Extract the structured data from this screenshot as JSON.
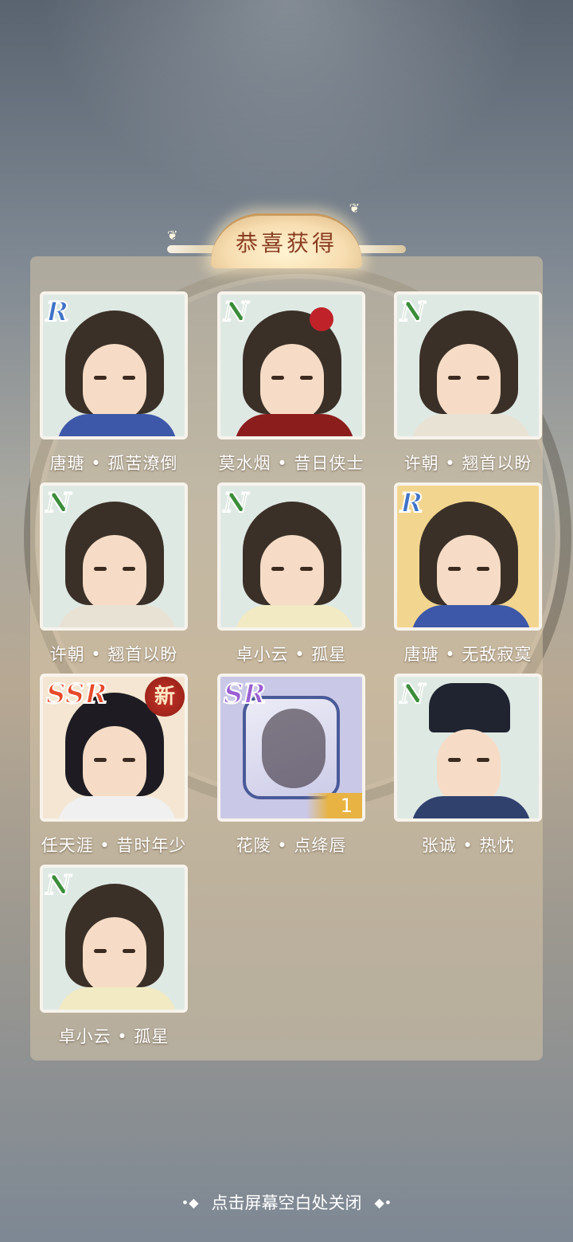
{
  "banner": {
    "title": "恭喜获得"
  },
  "rarity_colors": {
    "N": "#3b8d3a",
    "R": "#3f73c7",
    "SR": "#9b5fd3",
    "SSR": "#e64a2a"
  },
  "rewards": [
    {
      "rarity": "R",
      "name": "唐瑭 • 孤苦潦倒",
      "new": false,
      "count": null
    },
    {
      "rarity": "N",
      "name": "莫水烟 • 昔日侠士",
      "new": false,
      "count": null
    },
    {
      "rarity": "N",
      "name": "许朝 • 翘首以盼",
      "new": false,
      "count": null
    },
    {
      "rarity": "N",
      "name": "许朝 • 翘首以盼",
      "new": false,
      "count": null
    },
    {
      "rarity": "N",
      "name": "卓小云 • 孤星",
      "new": false,
      "count": null
    },
    {
      "rarity": "R",
      "name": "唐瑭 • 无敌寂寞",
      "new": false,
      "count": null
    },
    {
      "rarity": "SSR",
      "name": "任天涯 • 昔时年少",
      "new": true,
      "badge": "新",
      "count": null
    },
    {
      "rarity": "SR",
      "name": "花陵 • 点绛唇",
      "new": false,
      "count": "1"
    },
    {
      "rarity": "N",
      "name": "张诚 • 热忱",
      "new": false,
      "count": null
    },
    {
      "rarity": "N",
      "name": "卓小云 • 孤星",
      "new": false,
      "count": null
    }
  ],
  "footer": {
    "hint": "点击屏幕空白处关闭",
    "deco_left": "•◆",
    "deco_right": "◆•"
  }
}
